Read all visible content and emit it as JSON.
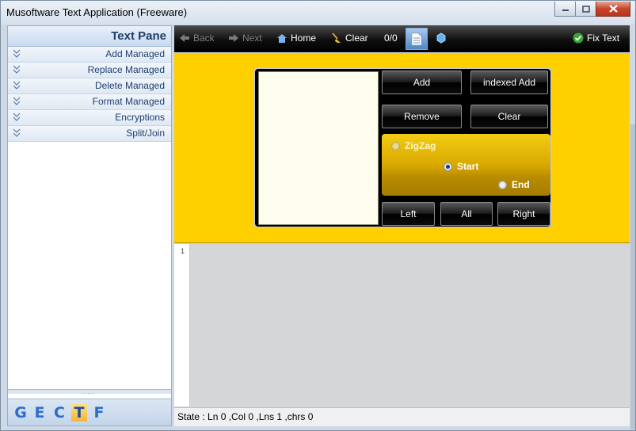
{
  "window": {
    "title": "Musoftware Text Application (Freeware)"
  },
  "left_pane": {
    "header": "Text Pane",
    "items": [
      {
        "label": "Add Managed"
      },
      {
        "label": "Replace Managed"
      },
      {
        "label": "Delete Managed"
      },
      {
        "label": "Format Managed"
      },
      {
        "label": "Encryptions"
      },
      {
        "label": "Split/Join"
      }
    ],
    "grip": ".....",
    "tabs": [
      {
        "letter": "G",
        "active": false
      },
      {
        "letter": "E",
        "active": false
      },
      {
        "letter": "C",
        "active": false
      },
      {
        "letter": "T",
        "active": true
      },
      {
        "letter": "F",
        "active": false
      }
    ]
  },
  "toolbar": {
    "back": "Back",
    "next": "Next",
    "home": "Home",
    "clear": "Clear",
    "count": "0/0",
    "fix_text": "Fix Text"
  },
  "panel": {
    "buttons": {
      "add": "Add",
      "indexed_add": "indexed Add",
      "remove": "Remove",
      "clear": "Clear",
      "left": "Left",
      "all": "All",
      "right": "Right"
    },
    "radios": {
      "zigzag": "ZigZag",
      "start": "Start",
      "end": "End"
    },
    "selected_radio": "Start"
  },
  "editor": {
    "line_marker": "1"
  },
  "status": {
    "text": "State :  Ln 0 ,Col 0 ,Lns 1 ,chrs 0"
  },
  "colors": {
    "accent_yellow": "#ffd000",
    "toolbar_black": "#000000",
    "pane_blue": "#1e3d6b"
  }
}
